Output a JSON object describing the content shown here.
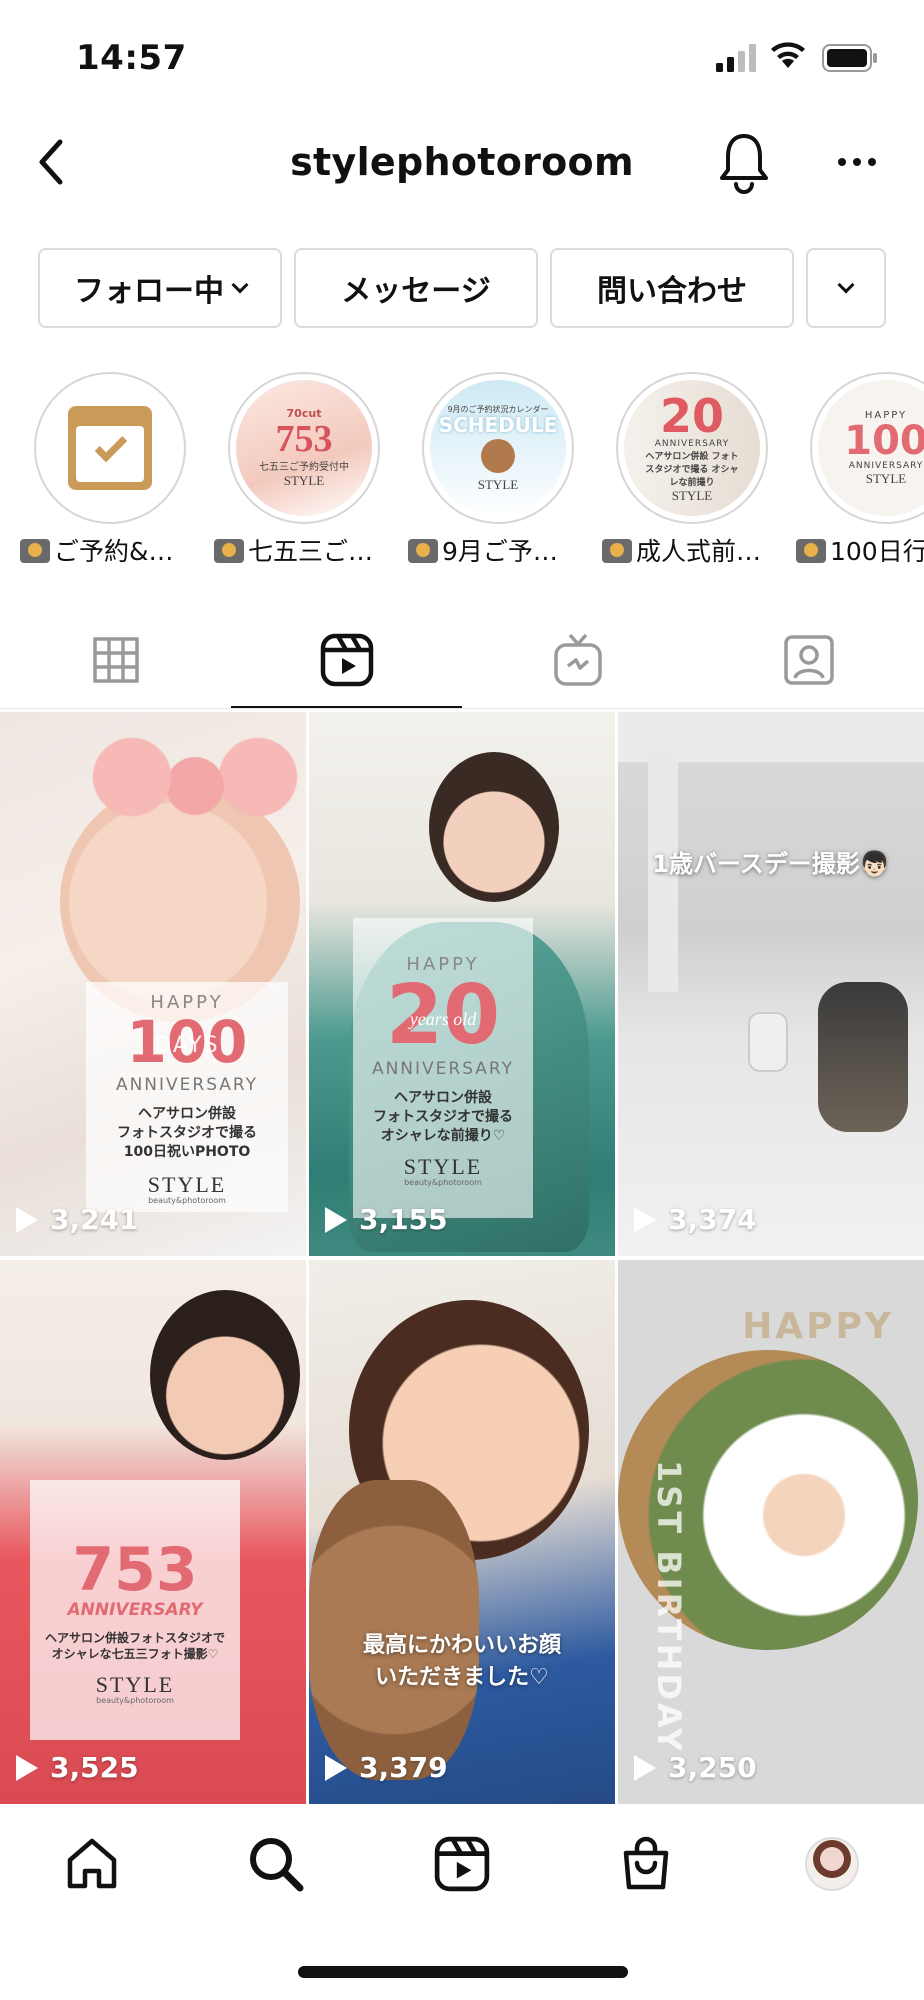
{
  "status_bar": {
    "time": "14:57",
    "icons": [
      "signal-icon",
      "wifi-icon",
      "battery-icon"
    ]
  },
  "header": {
    "username": "stylephotoroom",
    "icons": [
      "back-arrow-icon",
      "bell-icon",
      "more-icon"
    ]
  },
  "actions": {
    "follow": "フォロー中",
    "message": "メッセージ",
    "contact": "問い合わせ"
  },
  "highlights": [
    {
      "label": "ご予約&…",
      "art": "calendar"
    },
    {
      "label": "七五三ご…",
      "art_big": "753",
      "art_top": "70cut",
      "art_small": "七五三ご予約受付中",
      "art_brand": "STYLE"
    },
    {
      "label": "9月ご予…",
      "art_big": "SCHEDULE",
      "art_small": "9月のご予約状況カレンダー",
      "art_brand": "STYLE"
    },
    {
      "label": "成人式前…",
      "art_big": "20",
      "art_top": "ANNIVERSARY",
      "art_small": "ヘアサロン併設 フォトスタジオで撮る オシャレな前撮り",
      "art_brand": "STYLE"
    },
    {
      "label": "100日行",
      "art_big": "100",
      "art_top": "HAPPY",
      "art_small": "ANNIVERSARY",
      "art_brand": "STYLE"
    }
  ],
  "tabs": [
    {
      "name": "grid",
      "active": false
    },
    {
      "name": "reels",
      "active": true
    },
    {
      "name": "igtv",
      "active": false
    },
    {
      "name": "tagged",
      "active": false
    }
  ],
  "reels": [
    {
      "views": "3,241",
      "overlay": {
        "happy": "HAPPY",
        "big": "100",
        "sub_big": "DAYS",
        "anniversary": "ANNIVERSARY",
        "text": "ヘアサロン併設\nフォトスタジオで撮る\n100日祝いPHOTO",
        "brand": "STYLE",
        "brand_sub": "beauty&photoroom"
      }
    },
    {
      "views": "3,155",
      "overlay": {
        "happy": "HAPPY",
        "big": "20",
        "sub_big": "years old",
        "anniversary": "ANNIVERSARY",
        "text": "ヘアサロン併設\nフォトスタジオで撮る\nオシャレな前撮り♡",
        "brand": "STYLE",
        "brand_sub": "beauty&photoroom"
      }
    },
    {
      "views": "3,374",
      "caption": "1歳バースデー撮影👦🏻"
    },
    {
      "views": "3,525",
      "overlay": {
        "big": "753",
        "anniversary": "ANNIVERSARY",
        "text": "ヘアサロン併設フォトスタジオで\nオシャレな七五三フォト撮影♡",
        "brand": "STYLE",
        "brand_sub": "beauty&photoroom"
      }
    },
    {
      "views": "3,379",
      "caption": "最高にかわいいお顔\nいただきました♡"
    },
    {
      "views": "3,250",
      "top_text": "HAPPY",
      "side_text": "1ST BIRTHDAY"
    }
  ],
  "bottom_nav": [
    "home-icon",
    "search-icon",
    "reels-icon",
    "shop-icon",
    "profile-avatar"
  ]
}
